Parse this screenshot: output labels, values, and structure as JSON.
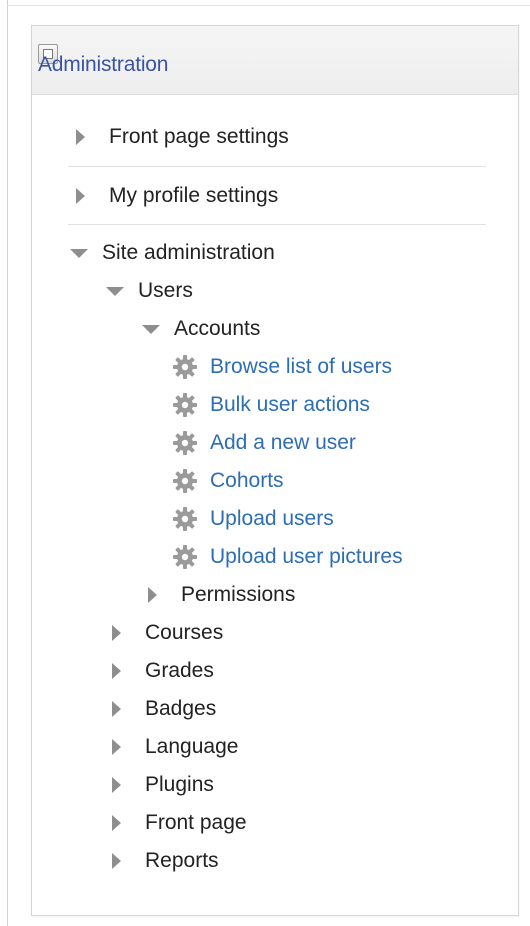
{
  "block": {
    "title": "Administration"
  },
  "nav": {
    "front_page_settings": "Front page settings",
    "my_profile_settings": "My profile settings",
    "site_administration": "Site administration",
    "users": "Users",
    "accounts": "Accounts",
    "account_links": [
      "Browse list of users",
      "Bulk user actions",
      "Add a new user",
      "Cohorts",
      "Upload users",
      "Upload user pictures"
    ],
    "permissions": "Permissions",
    "site_sections": [
      "Courses",
      "Grades",
      "Badges",
      "Language",
      "Plugins",
      "Front page",
      "Reports"
    ]
  },
  "icons": {
    "collapsed": "triangle-right-icon",
    "expanded": "triangle-down-icon",
    "settings": "gear-icon"
  },
  "colors": {
    "link": "#2c6db5",
    "title": "#3a53a4",
    "arrow": "#8e8e8e",
    "gear": "#9a9a9a"
  }
}
